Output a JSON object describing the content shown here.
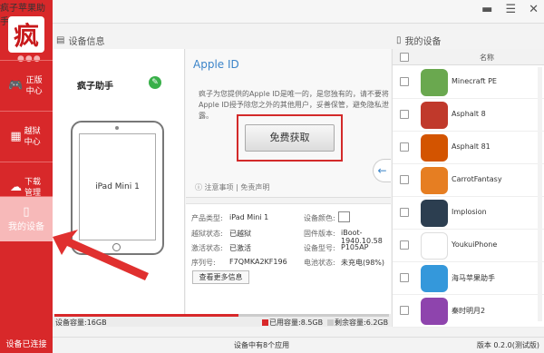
{
  "app": {
    "title": "疯子苹果助手",
    "logo_glyph": "疯",
    "logo_dots": "●●●",
    "accent_color": "#d8282a"
  },
  "window_controls": [
    "minimize-icon",
    "menu-icon",
    "close-icon"
  ],
  "sidebar": {
    "items": [
      {
        "icon": "gamepad-icon",
        "label": "正版中心"
      },
      {
        "icon": "grid-icon",
        "label": "越狱中心"
      },
      {
        "icon": "cloud-download-icon",
        "label": "下载管理"
      },
      {
        "icon": "phone-icon",
        "label": "我的设备",
        "active": true
      }
    ],
    "status": "设备已连接"
  },
  "device_pane": {
    "title": "设备信息",
    "brand": "疯子助手",
    "device_name": "iPad Mini 1"
  },
  "apple_panel": {
    "heading": "Apple ID",
    "description": "疯子为您提供的Apple ID是唯一的，是您独有的，请不要将Apple ID授予除您之外的其他用户，妥善保管，避免隐私泄露。",
    "get_button": "免费获取",
    "notes": "注意事项",
    "disclaimer": "免责声明"
  },
  "specs": {
    "rows": [
      {
        "k1": "产品类型:",
        "v1": "iPad Mini 1",
        "k2": "设备颜色:",
        "v2": ""
      },
      {
        "k1": "越狱状态:",
        "v1": "已越狱",
        "k2": "固件版本:",
        "v2": "iBoot-1940.10.58"
      },
      {
        "k1": "激活状态:",
        "v1": "已激活",
        "k2": "设备型号:",
        "v2": "P105AP"
      },
      {
        "k1": "序列号:",
        "v1": "F7QMKA2KF196",
        "k2": "电池状态:",
        "v2": "未充电(98%)"
      }
    ],
    "more_button": "查看更多信息"
  },
  "capacity": {
    "total_label": "设备容量:16GB",
    "used_label": "已用容量:8.5GB",
    "free_label": "剩余容量:6.2GB",
    "used_fraction": 0.55
  },
  "app_list": {
    "title": "我的设备",
    "column_name": "名称",
    "apps": [
      {
        "name": "Minecraft PE",
        "color": "#6aa84f"
      },
      {
        "name": "Asphalt 8",
        "color": "#c0392b"
      },
      {
        "name": "Asphalt 81",
        "color": "#d35400"
      },
      {
        "name": "CarrotFantasy",
        "color": "#e67e22"
      },
      {
        "name": "Implosion",
        "color": "#2c3e50"
      },
      {
        "name": "YoukuiPhone",
        "color": "#ffffff"
      },
      {
        "name": "海马苹果助手",
        "color": "#3498db"
      },
      {
        "name": "秦时明月2",
        "color": "#8e44ad"
      }
    ]
  },
  "statusbar": {
    "app_count": "设备中有8个应用",
    "version": "版本 0.2.0(测试版)"
  }
}
